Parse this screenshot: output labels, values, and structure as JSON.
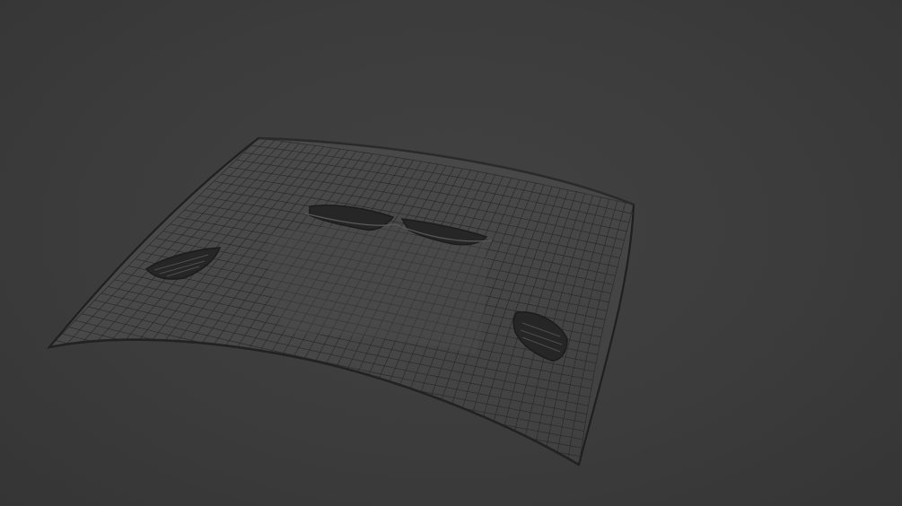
{
  "viewport": {
    "background_color": "#3d3d3d",
    "mesh_edge_color": "#262626",
    "mesh_fill_color": "#4a4a4a",
    "mesh_fill_shadow_color": "#3f3f3f",
    "object": "car-hood-wireframe-mesh"
  }
}
